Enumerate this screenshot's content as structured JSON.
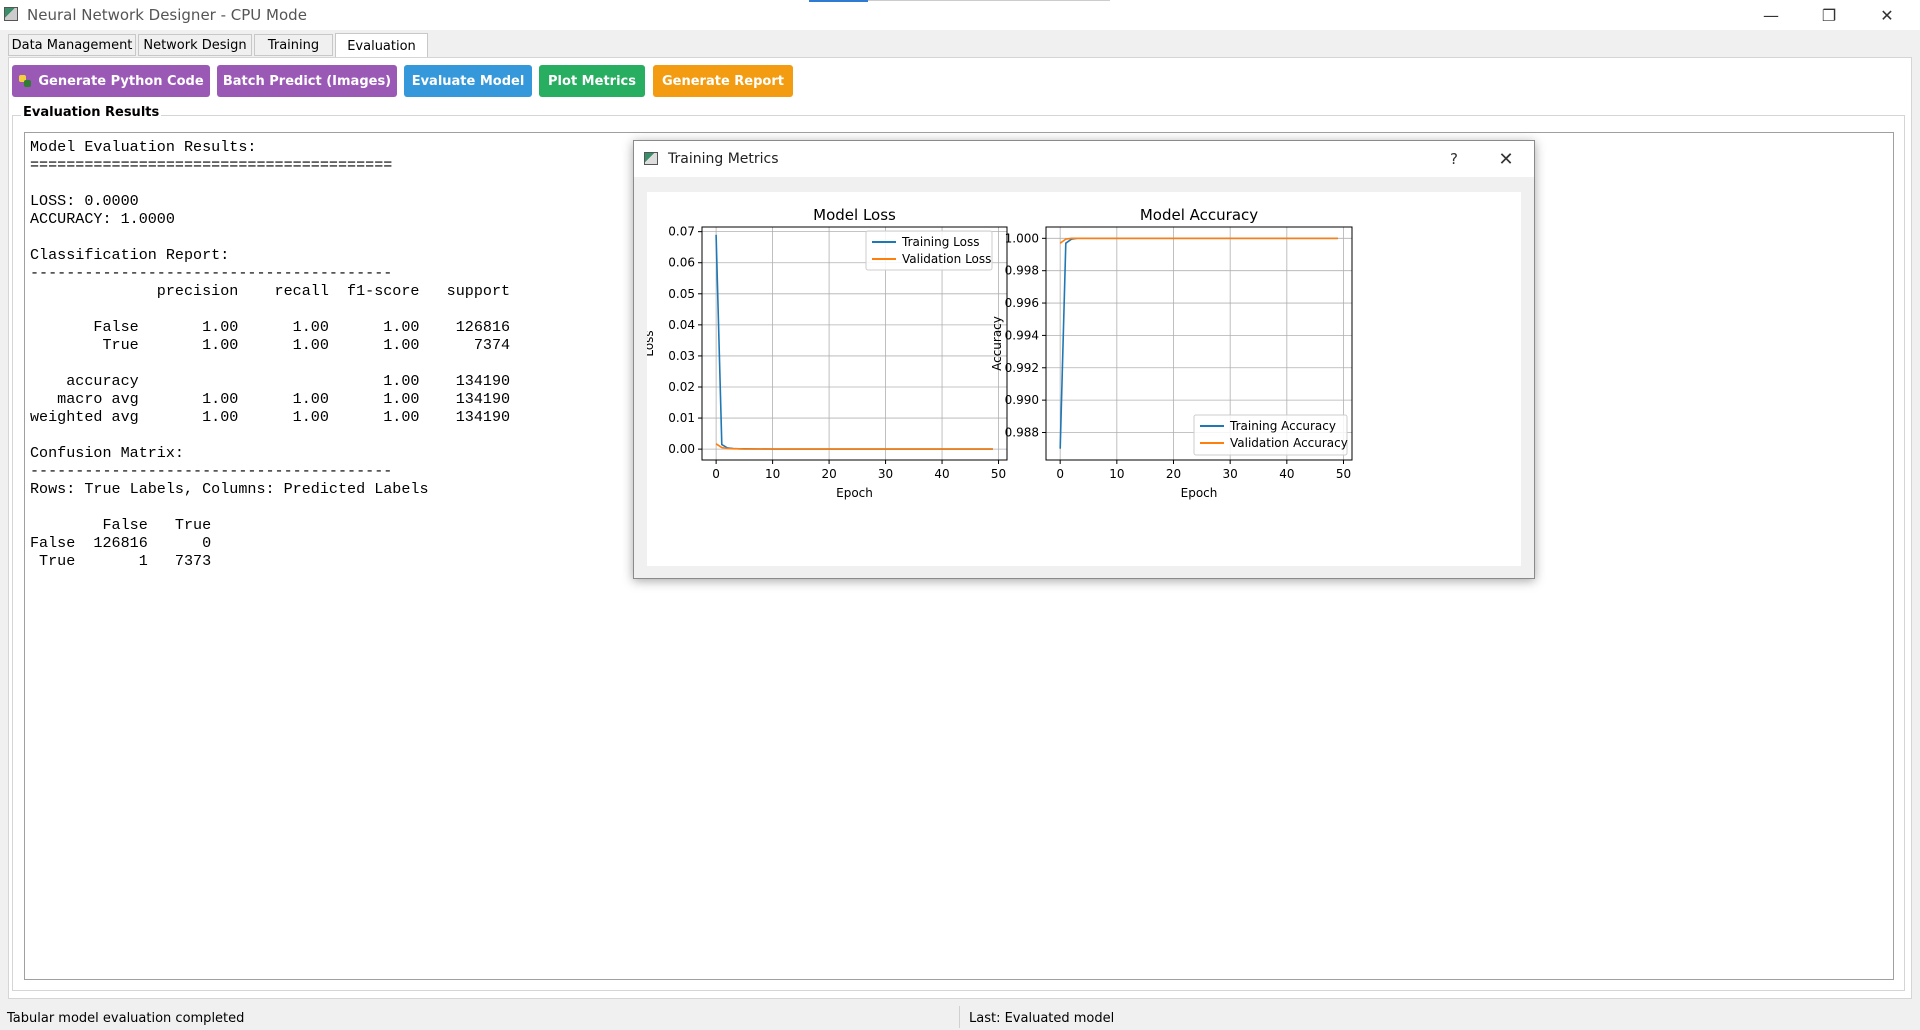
{
  "window": {
    "title": "Neural Network Designer - CPU Mode",
    "minimize_glyph": "—",
    "restore_glyph": "❐",
    "close_glyph": "✕"
  },
  "tabs": [
    {
      "label": "Data Management",
      "active": false
    },
    {
      "label": "Network Design",
      "active": false
    },
    {
      "label": "Training",
      "active": false
    },
    {
      "label": "Evaluation",
      "active": true
    }
  ],
  "toolbar": {
    "generate_code": {
      "label": "Generate Python Code",
      "color": "#9b59b6",
      "icon": "python-icon"
    },
    "batch_predict": {
      "label": "Batch Predict (Images)",
      "color": "#9b59b6"
    },
    "evaluate": {
      "label": "Evaluate Model",
      "color": "#3498db"
    },
    "plot_metrics": {
      "label": "Plot Metrics",
      "color": "#27ae60"
    },
    "generate_report": {
      "label": "Generate Report",
      "color": "#f39c12"
    }
  },
  "results": {
    "group_title": "Evaluation Results",
    "text": "Model Evaluation Results:\n========================================\n\nLOSS: 0.0000\nACCURACY: 1.0000\n\nClassification Report:\n----------------------------------------\n              precision    recall  f1-score   support\n\n       False       1.00      1.00      1.00    126816\n        True       1.00      1.00      1.00      7374\n\n    accuracy                           1.00    134190\n   macro avg       1.00      1.00      1.00    134190\nweighted avg       1.00      1.00      1.00    134190\n\nConfusion Matrix:\n----------------------------------------\nRows: True Labels, Columns: Predicted Labels\n\n        False   True\nFalse  126816      0\n True       1   7373"
  },
  "status": {
    "left": "Tabular model evaluation completed",
    "right": "Last: Evaluated model"
  },
  "dialog": {
    "title": "Training Metrics",
    "help_glyph": "?",
    "close_glyph": "✕"
  },
  "chart_data": [
    {
      "type": "line",
      "title": "Model Loss",
      "xlabel": "Epoch",
      "ylabel": "Loss",
      "xlim": [
        -2.5,
        51.5
      ],
      "ylim": [
        -0.0035,
        0.0715
      ],
      "xticks": [
        0,
        10,
        20,
        30,
        40,
        50
      ],
      "yticks": [
        0.0,
        0.01,
        0.02,
        0.03,
        0.04,
        0.05,
        0.06,
        0.07
      ],
      "ytick_decimals": 2,
      "grid": true,
      "legend": "upper right",
      "series": [
        {
          "name": "Training Loss",
          "color": "#1f77b4",
          "x": [
            0,
            1,
            2,
            3,
            4,
            5,
            10,
            20,
            30,
            40,
            49
          ],
          "y": [
            0.069,
            0.0015,
            0.0004,
            0.0002,
            0.0001,
            0.0001,
            0.0,
            0.0,
            0.0,
            0.0,
            0.0
          ]
        },
        {
          "name": "Validation Loss",
          "color": "#ff7f0e",
          "x": [
            0,
            1,
            2,
            3,
            4,
            5,
            10,
            20,
            30,
            40,
            49
          ],
          "y": [
            0.0017,
            0.0005,
            0.0002,
            0.0001,
            0.0001,
            0.0,
            0.0,
            0.0,
            0.0,
            0.0,
            0.0
          ]
        }
      ]
    },
    {
      "type": "line",
      "title": "Model Accuracy",
      "xlabel": "Epoch",
      "ylabel": "Accuracy",
      "xlim": [
        -2.5,
        51.5
      ],
      "ylim": [
        0.9863,
        1.0007
      ],
      "xticks": [
        0,
        10,
        20,
        30,
        40,
        50
      ],
      "yticks": [
        0.988,
        0.99,
        0.992,
        0.994,
        0.996,
        0.998,
        1.0
      ],
      "ytick_decimals": 3,
      "grid": true,
      "legend": "lower right",
      "series": [
        {
          "name": "Training Accuracy",
          "color": "#1f77b4",
          "x": [
            0,
            1,
            2,
            3,
            5,
            10,
            20,
            30,
            40,
            49
          ],
          "y": [
            0.987,
            0.9997,
            0.99995,
            1.0,
            1.0,
            1.0,
            1.0,
            1.0,
            1.0,
            1.0
          ]
        },
        {
          "name": "Validation Accuracy",
          "color": "#ff7f0e",
          "x": [
            0,
            1,
            2,
            3,
            5,
            10,
            20,
            30,
            40,
            49
          ],
          "y": [
            0.9997,
            0.99995,
            1.0,
            1.0,
            1.0,
            1.0,
            1.0,
            1.0,
            1.0,
            1.0
          ]
        }
      ]
    }
  ]
}
